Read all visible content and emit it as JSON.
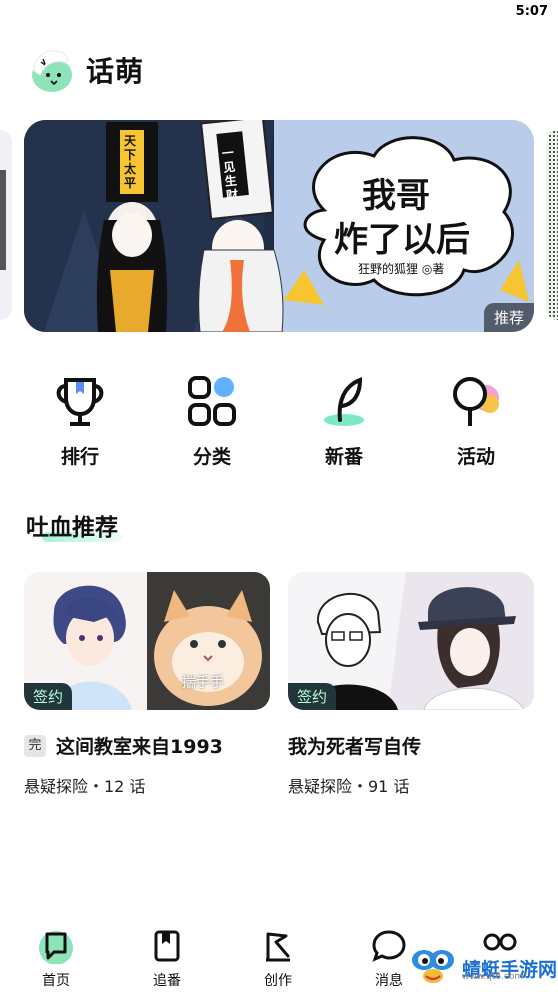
{
  "status_bar": {
    "time": "5:07"
  },
  "header": {
    "app_name": "话萌",
    "logo_icon": "mascot-logo-icon"
  },
  "banner": {
    "comic_title_line1": "我哥",
    "comic_title_line2": "炸了以后",
    "author": "狂野的狐狸",
    "author_suffix": "◎著",
    "tag": "推荐",
    "sign_text_1": "天下太平",
    "sign_text_2": "一见生财"
  },
  "quick_nav": [
    {
      "label": "排行",
      "icon": "trophy-icon"
    },
    {
      "label": "分类",
      "icon": "category-grid-icon"
    },
    {
      "label": "新番",
      "icon": "sprout-icon"
    },
    {
      "label": "活动",
      "icon": "balloons-icon"
    }
  ],
  "section": {
    "title": "吐血推荐"
  },
  "cards": [
    {
      "badge": "签约",
      "done_badge": "完",
      "title": "这间教室来自1993",
      "meta": "悬疑探险・12 话",
      "cover_caption": "揣手手"
    },
    {
      "badge": "签约",
      "title": "我为死者写自传",
      "meta": "悬疑探险・91 话"
    }
  ],
  "tab_bar": [
    {
      "label": "首页",
      "icon": "home-chat-icon",
      "active": true
    },
    {
      "label": "追番",
      "icon": "bookmark-book-icon"
    },
    {
      "label": "创作",
      "icon": "pen-flag-icon"
    },
    {
      "label": "消息",
      "icon": "message-bubble-icon"
    },
    {
      "label": "",
      "icon": "profile-face-icon"
    }
  ],
  "watermark": {
    "text": "蜻蜓手游网",
    "url": "www.qt6.com"
  },
  "colors": {
    "accent": "#7ee8c6",
    "badge_bg": "#21353b",
    "badge_text": "#b6ffd9",
    "watermark": "#1a6fd1"
  }
}
